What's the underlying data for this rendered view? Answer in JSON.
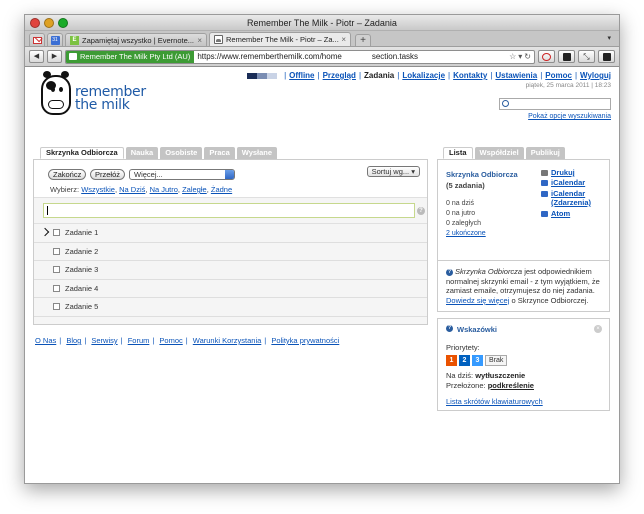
{
  "browser": {
    "window_title": "Remember The Milk - Piotr – Zadania",
    "tabs": [
      {
        "label": "Zapamiętaj wszystko | Evernote..."
      },
      {
        "label": "Remember The Milk - Piotr – Za..."
      }
    ],
    "new_tab_label": "+",
    "tab_menu_label": "▾",
    "identity_label": "Remember The Milk Pty Ltd (AU)",
    "url_start": "https://www.rememberthemilk.com/home",
    "url_end": "section.tasks",
    "favicon_calendar": "31",
    "favicon_evernote": "E"
  },
  "header": {
    "nav": [
      {
        "label": "Offline",
        "current": false
      },
      {
        "label": "Przegląd",
        "current": false
      },
      {
        "label": "Zadania",
        "current": true
      },
      {
        "label": "Lokalizacje",
        "current": false
      },
      {
        "label": "Kontakty",
        "current": false
      },
      {
        "label": "Ustawienia",
        "current": false
      },
      {
        "label": "Pomoc",
        "current": false
      },
      {
        "label": "Wyloguj",
        "current": false
      }
    ],
    "date": "piątek, 25 marca 2011 | 18:23",
    "logo_line1": "remember",
    "logo_line2": "the milk",
    "search_options_link": "Pokaż opcje wyszukiwania"
  },
  "list_tabs": [
    {
      "label": "Skrzynka Odbiorcza",
      "active": true
    },
    {
      "label": "Nauka",
      "active": false
    },
    {
      "label": "Osobiste",
      "active": false
    },
    {
      "label": "Praca",
      "active": false
    },
    {
      "label": "Wysłane",
      "active": false
    }
  ],
  "toolbar": {
    "complete_label": "Zakończ",
    "postpone_label": "Przełóż",
    "more_label": "Więcej...",
    "sort_label": "Sortuj wg... ▾",
    "select_prefix": "Wybierz:",
    "select_options": [
      "Wszystkie",
      "Na Dziś",
      "Na Jutro",
      "Zaległe",
      "Żadne"
    ]
  },
  "add_help_icon": "?",
  "tasks": [
    {
      "name": "Zadanie 1"
    },
    {
      "name": "Zadanie 2"
    },
    {
      "name": "Zadanie 3"
    },
    {
      "name": "Zadanie 4"
    },
    {
      "name": "Zadanie 5"
    }
  ],
  "footer_links": [
    "O Nas",
    "Blog",
    "Serwisy",
    "Forum",
    "Pomoc",
    "Warunki Korzystania",
    "Polityka prywatności"
  ],
  "right_tabs": [
    {
      "label": "Lista",
      "active": true
    },
    {
      "label": "Współdziel",
      "active": false
    },
    {
      "label": "Publikuj",
      "active": false
    }
  ],
  "list_info": {
    "title": "Skrzynka Odbiorcza",
    "count": "(5 zadania)",
    "today": "0 na dziś",
    "tomorrow": "0 na jutro",
    "overdue": "0 zaległych",
    "completed": "2 ukończone",
    "actions": [
      "Drukuj",
      "iCalendar",
      "iCalendar",
      "(Zdarzenia)",
      "Atom"
    ]
  },
  "help": {
    "icon": "?",
    "list_name": "Skrzynka Odbiorcza",
    "text": " jest odpowiednikiem normalnej skrzynki email - z tym wyjątkiem, że zamiast emaile, otrzymujesz do niej zadania. ",
    "link": "Dowiedz się więcej",
    "after": " o Skrzynce Odbiorczej."
  },
  "tips": {
    "icon": "?",
    "close_icon": "×",
    "title": "Wskazówki",
    "priorities_label": "Priorytety:",
    "priorities": [
      "1",
      "2",
      "3"
    ],
    "priority_none": "Brak",
    "today_label": "Na dziś: ",
    "today_value": "wytłuszczenie",
    "postponed_label": "Przełożone: ",
    "postponed_value": "podkreślenie",
    "shortcuts_link": "Lista skrótów klawiaturowych"
  },
  "colors": {
    "link": "#0a53b8",
    "identity_green": "#3d9b35",
    "priority_1": "#ea5200",
    "priority_2": "#0060bf",
    "priority_3": "#359aff"
  }
}
